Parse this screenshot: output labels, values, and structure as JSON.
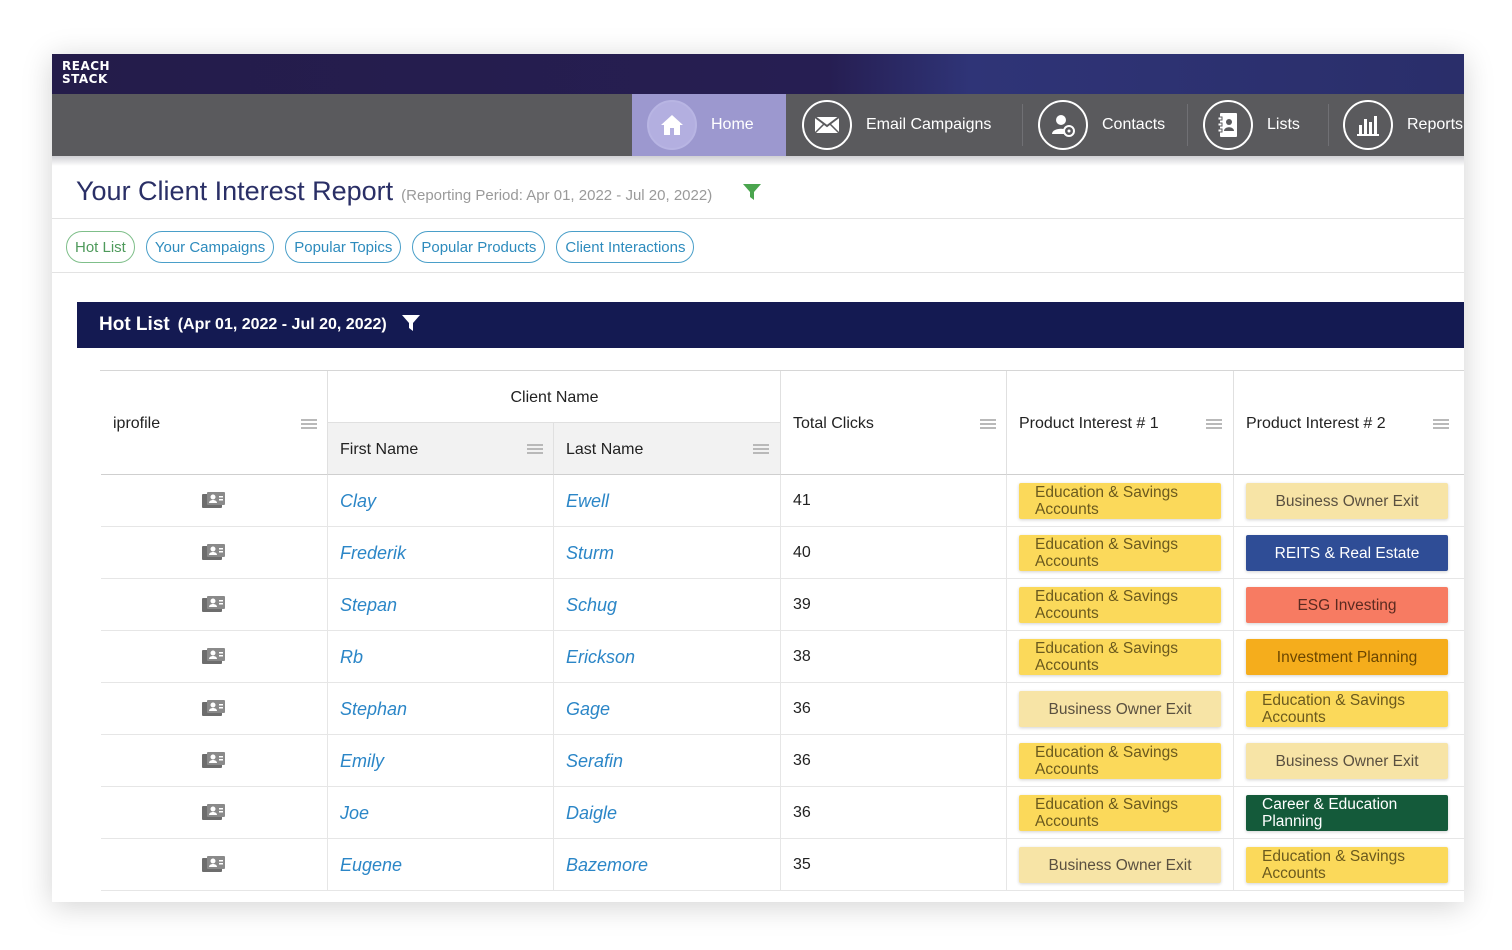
{
  "brand": {
    "logo_line1": "REACH",
    "logo_line2": "STACK"
  },
  "nav": {
    "items": [
      {
        "label": "Home",
        "icon": "home-icon",
        "active": true
      },
      {
        "label": "Email Campaigns",
        "icon": "envelope-icon",
        "active": false
      },
      {
        "label": "Contacts",
        "icon": "contact-user-icon",
        "active": false
      },
      {
        "label": "Lists",
        "icon": "address-book-icon",
        "active": false
      },
      {
        "label": "Reports",
        "icon": "bar-chart-icon",
        "active": false
      }
    ]
  },
  "page": {
    "title": "Your Client Interest Report",
    "reporting_period": "(Reporting Period: Apr 01, 2022 - Jul 20, 2022)",
    "filter_color": "#4aa54e"
  },
  "pills": [
    {
      "label": "Hot List",
      "active": true
    },
    {
      "label": "Your Campaigns",
      "active": false
    },
    {
      "label": "Popular Topics",
      "active": false
    },
    {
      "label": "Popular Products",
      "active": false
    },
    {
      "label": "Client Interactions",
      "active": false
    }
  ],
  "hotlist": {
    "title": "Hot List",
    "range": "(Apr 01, 2022 - Jul 20, 2022)",
    "header_color": "#141a52"
  },
  "table": {
    "headers": {
      "iprofile": "iprofile",
      "client_name": "Client Name",
      "first_name": "First Name",
      "last_name": "Last Name",
      "total_clicks": "Total Clicks",
      "product1": "Product Interest # 1",
      "product2": "Product Interest # 2"
    },
    "rows": [
      {
        "first": "Clay",
        "last": "Ewell",
        "clicks": "41",
        "p1": {
          "label": "Education & Savings Accounts",
          "style": "edu"
        },
        "p2": {
          "label": "Business Owner Exit",
          "style": "exit"
        }
      },
      {
        "first": "Frederik",
        "last": "Sturm",
        "clicks": "40",
        "p1": {
          "label": "Education & Savings Accounts",
          "style": "edu"
        },
        "p2": {
          "label": "REITS & Real Estate",
          "style": "reits"
        }
      },
      {
        "first": "Stepan",
        "last": "Schug",
        "clicks": "39",
        "p1": {
          "label": "Education & Savings Accounts",
          "style": "edu"
        },
        "p2": {
          "label": "ESG Investing",
          "style": "esg"
        }
      },
      {
        "first": "Rb",
        "last": "Erickson",
        "clicks": "38",
        "p1": {
          "label": "Education & Savings Accounts",
          "style": "edu"
        },
        "p2": {
          "label": "Investment Planning",
          "style": "invest"
        }
      },
      {
        "first": "Stephan",
        "last": "Gage",
        "clicks": "36",
        "p1": {
          "label": "Business Owner Exit",
          "style": "exit"
        },
        "p2": {
          "label": "Education & Savings Accounts",
          "style": "edu"
        }
      },
      {
        "first": "Emily",
        "last": "Serafin",
        "clicks": "36",
        "p1": {
          "label": "Education & Savings Accounts",
          "style": "edu"
        },
        "p2": {
          "label": "Business Owner Exit",
          "style": "exit"
        }
      },
      {
        "first": "Joe",
        "last": "Daigle",
        "clicks": "36",
        "p1": {
          "label": "Education & Savings Accounts",
          "style": "edu"
        },
        "p2": {
          "label": "Career & Education Planning",
          "style": "career"
        }
      },
      {
        "first": "Eugene",
        "last": "Bazemore",
        "clicks": "35",
        "p1": {
          "label": "Business Owner Exit",
          "style": "exit"
        },
        "p2": {
          "label": "Education & Savings Accounts",
          "style": "edu"
        }
      }
    ]
  },
  "tag_styles": {
    "edu": {
      "bg": "#fbd95a",
      "fg": "#6b5a1e",
      "center": false
    },
    "exit": {
      "bg": "#f7e4a6",
      "fg": "#5a5040",
      "center": true
    },
    "reits": {
      "bg": "#2f4d96",
      "fg": "#ffffff",
      "center": true
    },
    "esg": {
      "bg": "#f77b62",
      "fg": "#5b2a20",
      "center": true
    },
    "invest": {
      "bg": "#f5ad1c",
      "fg": "#6b4600",
      "center": true
    },
    "career": {
      "bg": "#145a3a",
      "fg": "#ffffff",
      "center": false
    }
  }
}
